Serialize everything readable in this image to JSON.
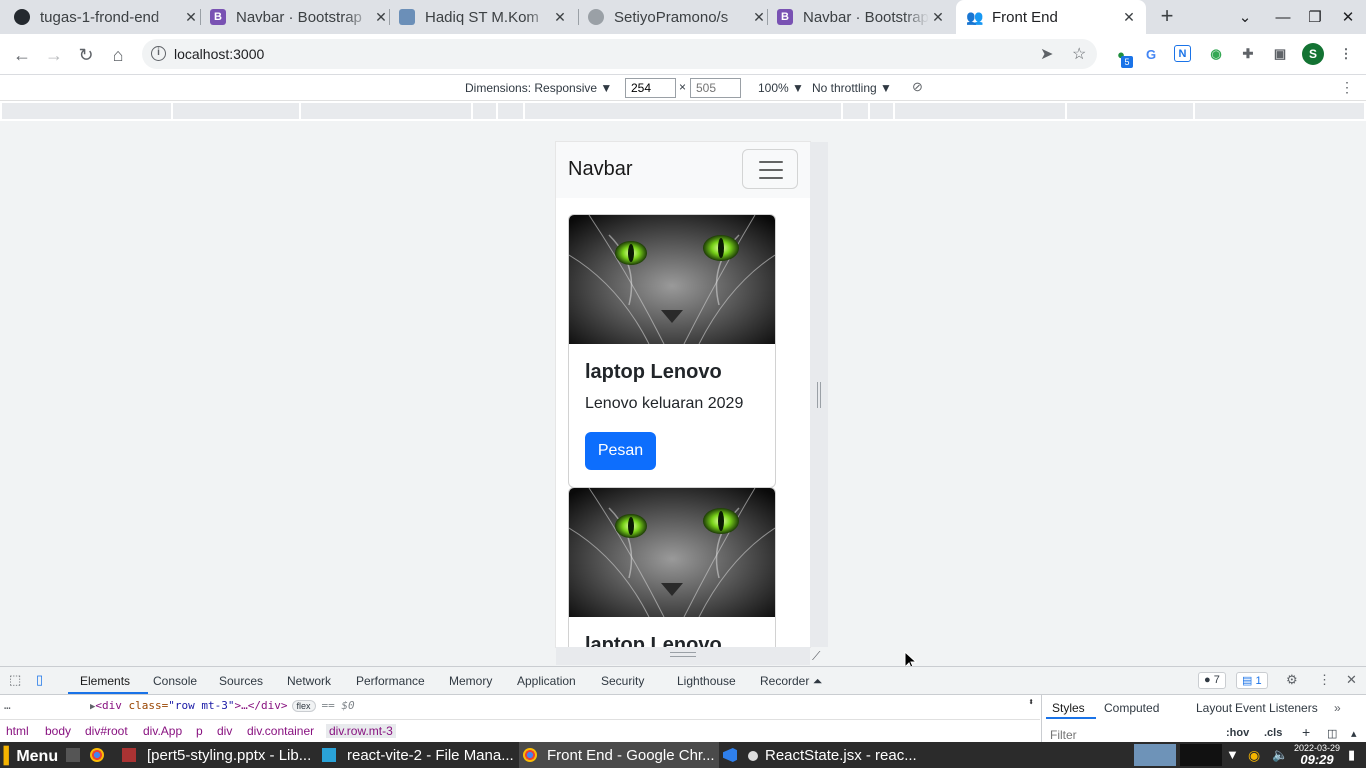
{
  "browser": {
    "tabs": [
      {
        "title": "tugas-1-frond-end",
        "icon": "github-icon"
      },
      {
        "title": "Navbar · Bootstrap",
        "icon": "bootstrap-icon"
      },
      {
        "title": "Hadiq ST M.Kom",
        "icon": "image-icon"
      },
      {
        "title": "SetiyoPramono/s",
        "icon": "github-icon"
      },
      {
        "title": "Navbar · Bootstrap",
        "icon": "bootstrap-icon"
      },
      {
        "title": "Front End",
        "icon": "people-icon",
        "active": true
      }
    ],
    "url": "localhost:3000",
    "profile_initial": "S",
    "extension_badge": "5"
  },
  "device_toolbar": {
    "dimensions_label": "Dimensions: Responsive ▼",
    "width": "254",
    "height_placeholder": "505",
    "times": "×",
    "zoom": "100% ▼",
    "throttling": "No throttling ▼"
  },
  "page": {
    "navbar": {
      "brand": "Navbar"
    },
    "cards": [
      {
        "title": "laptop Lenovo",
        "text": "Lenovo keluaran 2029",
        "button": "Pesan"
      },
      {
        "title": "laptop Lenovo",
        "text": "",
        "button": ""
      }
    ]
  },
  "devtools": {
    "tabs": [
      "Elements",
      "Console",
      "Sources",
      "Network",
      "Performance",
      "Memory",
      "Application",
      "Security",
      "Lighthouse",
      "Recorder ⏶"
    ],
    "errors_count": "7",
    "messages_count": "1",
    "dom_line": {
      "tag_open": "<div ",
      "attr": "class=",
      "val": "\"row mt-3\"",
      "rest": ">…</div>",
      "badge": "flex",
      "eq": "== $0"
    },
    "breadcrumbs": [
      "html",
      "body",
      "div#root",
      "div.App",
      "p",
      "div",
      "div.container",
      "div.row.mt-3"
    ],
    "styles_tabs": [
      "Styles",
      "Computed",
      "Layout",
      "Event Listeners"
    ],
    "filter_placeholder": "Filter",
    "hov": ":hov",
    "cls": ".cls"
  },
  "taskbar": {
    "menu": "Menu",
    "items": [
      "[pert5-styling.pptx - Lib...",
      "react-vite-2 - File Mana...",
      "Front End - Google Chr...",
      "ReactState.jsx - reac..."
    ],
    "date": "2022-03-29",
    "time": "09:29"
  },
  "colors": {
    "primary_button": "#0d6efd",
    "navbar_bg": "#f8f9fa",
    "devtools_accent": "#1a73e8"
  }
}
